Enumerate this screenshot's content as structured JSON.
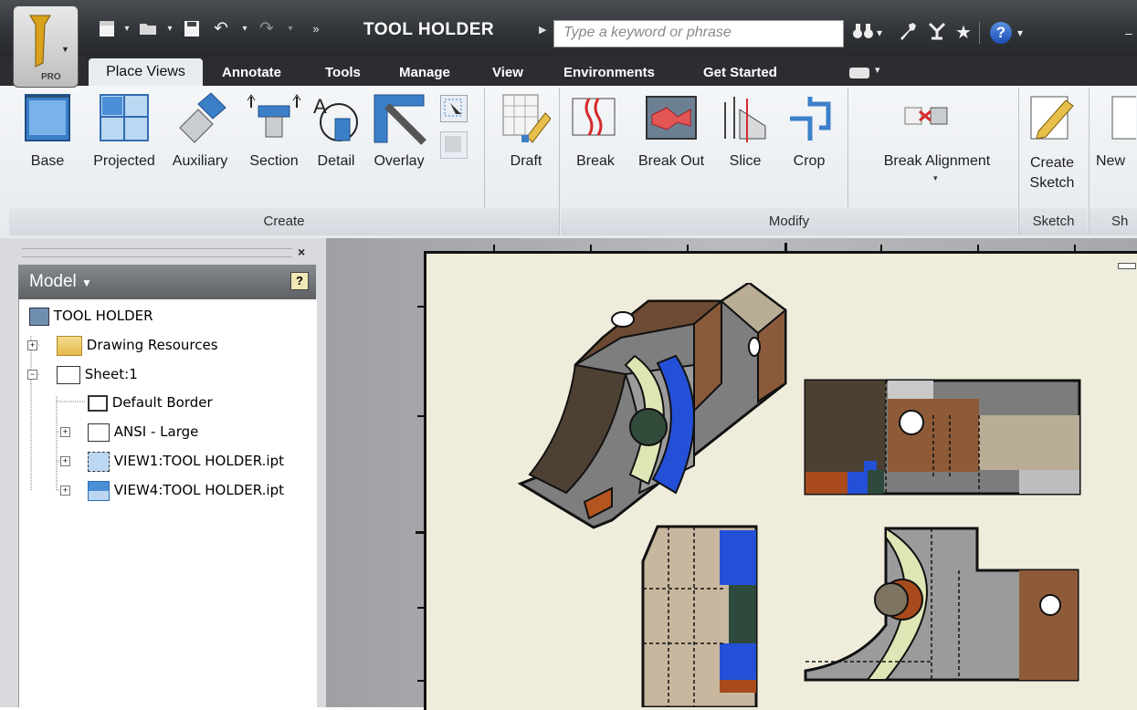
{
  "app": {
    "logo_label": "PRO",
    "document_title": "TOOL HOLDER",
    "search_placeholder": "Type a keyword or phrase"
  },
  "tabs": [
    {
      "label": "Place Views",
      "active": true
    },
    {
      "label": "Annotate"
    },
    {
      "label": "Tools"
    },
    {
      "label": "Manage"
    },
    {
      "label": "View"
    },
    {
      "label": "Environments"
    },
    {
      "label": "Get Started"
    }
  ],
  "ribbon": {
    "groups": [
      {
        "label": "Create"
      },
      {
        "label": "Modify"
      },
      {
        "label": "Sketch"
      },
      {
        "label": "Sh"
      }
    ],
    "buttons": [
      {
        "label": "Base"
      },
      {
        "label": "Projected"
      },
      {
        "label": "Auxiliary"
      },
      {
        "label": "Section"
      },
      {
        "label": "Detail"
      },
      {
        "label": "Overlay"
      },
      {
        "label": "Draft"
      },
      {
        "label": "Break"
      },
      {
        "label": "Break Out"
      },
      {
        "label": "Slice"
      },
      {
        "label": "Crop"
      },
      {
        "label": "Break Alignment"
      },
      {
        "label": "Create\nSketch",
        "line1": "Create",
        "line2": "Sketch"
      },
      {
        "label": "New"
      }
    ]
  },
  "browser": {
    "title": "Model",
    "tree": [
      {
        "label": "TOOL HOLDER"
      },
      {
        "label": "Drawing Resources"
      },
      {
        "label": "Sheet:1"
      },
      {
        "label": "Default Border"
      },
      {
        "label": "ANSI - Large"
      },
      {
        "label": "VIEW1:TOOL HOLDER.ipt"
      },
      {
        "label": "VIEW4:TOOL HOLDER.ipt"
      }
    ]
  },
  "colors": {
    "titlebar": "#2f3236",
    "sheet": "#efecdb",
    "section_blue": "#2450d8",
    "wood": "#8a5a3a",
    "metal": "#9a9a9a",
    "light_green": "#dfe6b5",
    "orange": "#b4551f"
  },
  "icons": [
    "new-file-icon",
    "open-icon",
    "save-icon",
    "undo-icon",
    "redo-icon",
    "binoculars-icon",
    "wrench-icon",
    "satellite-icon",
    "star-icon",
    "help-icon"
  ]
}
